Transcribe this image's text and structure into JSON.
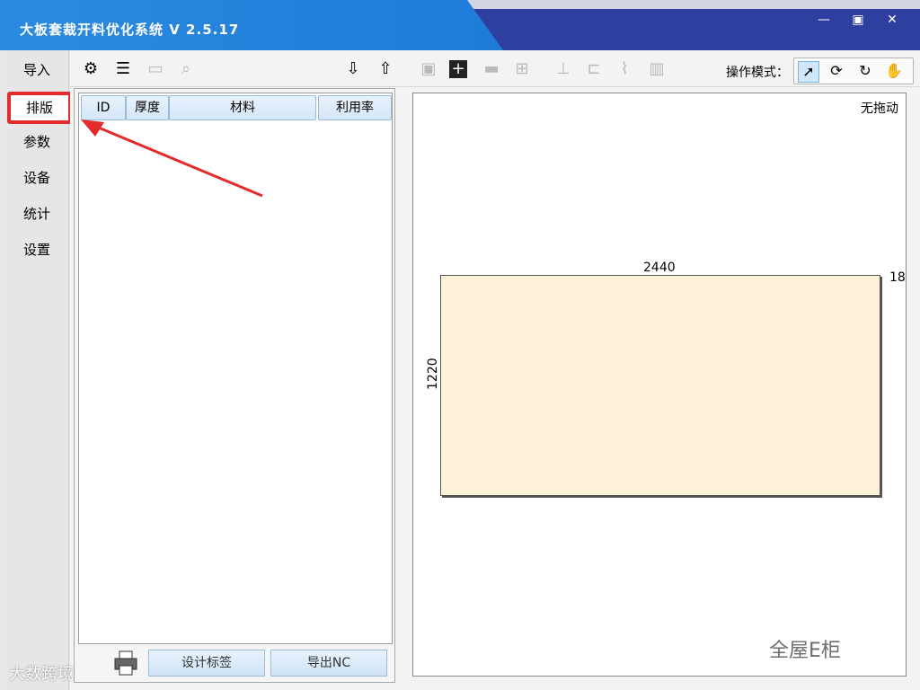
{
  "app": {
    "title": "大板套裁开料优化系统  V 2.5.17"
  },
  "window": {
    "minimize": "—",
    "maximize": "▣",
    "close": "✕"
  },
  "sidebar": {
    "items": [
      {
        "label": "导入"
      },
      {
        "label": "排版"
      },
      {
        "label": "参数"
      },
      {
        "label": "设备"
      },
      {
        "label": "统计"
      },
      {
        "label": "设置"
      }
    ],
    "active_index": 1
  },
  "toolbar": {
    "mode_label": "操作模式：",
    "icons": [
      "gear-icon",
      "layers-icon",
      "image-icon",
      "search-image-icon",
      "import-icon",
      "export-icon",
      "save-icon",
      "add-icon",
      "remove-icon",
      "add-box-icon",
      "align-bottom-icon",
      "align-left-icon",
      "chart-icon",
      "bar-chart-icon"
    ],
    "mode_buttons": [
      "pointer-icon",
      "rotate-cw-icon",
      "rotate-ccw-icon",
      "hand-icon"
    ]
  },
  "table": {
    "columns": [
      "ID",
      "厚度",
      "材料",
      "利用率"
    ],
    "rows": []
  },
  "buttons": {
    "design_label": "设计标签",
    "export_nc": "导出NC"
  },
  "canvas": {
    "status": "无拖动",
    "board_width": "2440",
    "board_height": "1220",
    "board_thickness": "18",
    "board_color": "#fff2d8"
  },
  "watermarks": {
    "right": "全屋E柜",
    "left": "大数跨境"
  },
  "colors": {
    "accent": "#2b8ae0",
    "highlight": "#e42b2b"
  }
}
